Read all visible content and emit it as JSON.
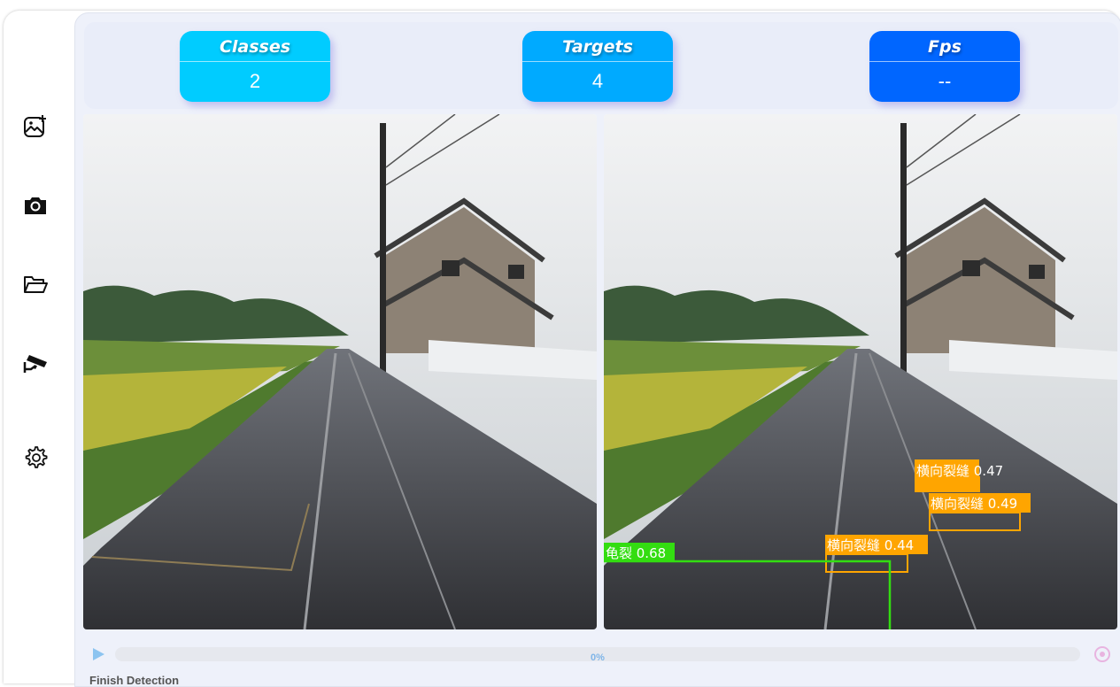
{
  "sidebar": {
    "items": [
      {
        "icon": "add-image-icon"
      },
      {
        "icon": "camera-icon"
      },
      {
        "icon": "folder-open-icon"
      },
      {
        "icon": "cctv-camera-icon"
      },
      {
        "icon": "gear-icon"
      }
    ]
  },
  "stats": {
    "classes": {
      "title": "Classes",
      "value": "2",
      "color": "#00ccff"
    },
    "targets": {
      "title": "Targets",
      "value": "4",
      "color": "#00aaff"
    },
    "fps": {
      "title": "Fps",
      "value": "--",
      "color": "#0066ff"
    }
  },
  "detections": [
    {
      "label": "横向裂缝 0.47",
      "color": "#ffa500"
    },
    {
      "label": "横向裂缝 0.49",
      "color": "#ffa500"
    },
    {
      "label": "横向裂缝 0.44",
      "color": "#ffa500"
    },
    {
      "label": "龟裂 0.68",
      "color": "#33dd11"
    }
  ],
  "progress": {
    "percent": 0,
    "label": "0%"
  },
  "status": "Finish Detection"
}
